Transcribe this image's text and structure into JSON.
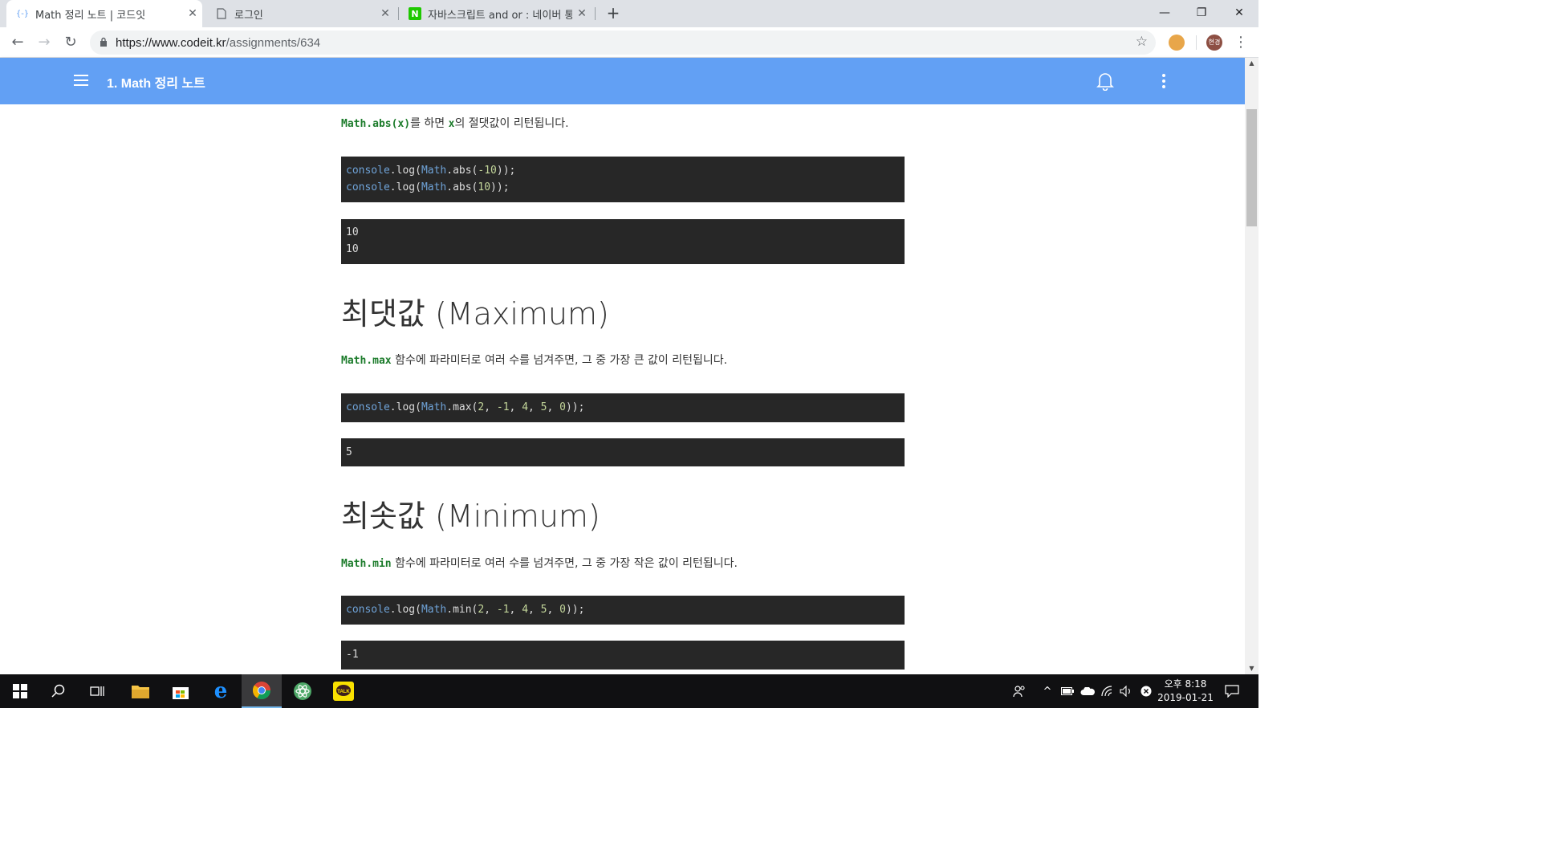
{
  "browser": {
    "tabs": [
      {
        "title": "Math 정리 노트 | 코드잇",
        "favicon": "codeit-favicon",
        "active": true
      },
      {
        "title": "로그인",
        "favicon": "page-icon",
        "active": false
      },
      {
        "title": "자바스크립트 and or : 네이버 통",
        "favicon": "naver-favicon",
        "active": false
      }
    ],
    "new_tab": "+",
    "url_host": "https://www.codeit.kr",
    "url_path": "/assignments/634",
    "profile_initials": "현경"
  },
  "app": {
    "title": "1. Math 정리 노트"
  },
  "content": {
    "abs_para": {
      "code1": "Math.abs(x)",
      "text1": "를 하면 ",
      "code2": "x",
      "text2": "의 절댓값이 리턴됩니다."
    },
    "abs_code": [
      {
        "obj": "console",
        "fn": ".log(",
        "obj2": "Math",
        "fn2": ".abs(",
        "num": "-10",
        "end": "));"
      },
      {
        "obj": "console",
        "fn": ".log(",
        "obj2": "Math",
        "fn2": ".abs(",
        "num": "10",
        "end": "));"
      }
    ],
    "abs_output": [
      "10",
      "10"
    ],
    "max_heading": "최댓값 (Maximum)",
    "max_para": {
      "code": "Math.max",
      "text": " 함수에 파라미터로 여러 수를 넘겨주면, 그 중 가장 큰 값이 리턴됩니다."
    },
    "max_code": {
      "obj": "console",
      "fn": ".log(",
      "obj2": "Math",
      "fn2": ".max(",
      "args": [
        "2",
        "-1",
        "4",
        "5",
        "0"
      ],
      "end": "));"
    },
    "max_output": "5",
    "min_heading": "최솟값 (Minimum)",
    "min_para": {
      "code": "Math.min",
      "text": " 함수에 파라미터로 여러 수를 넘겨주면, 그 중 가장 작은 값이 리턴됩니다."
    },
    "min_code": {
      "obj": "console",
      "fn": ".log(",
      "obj2": "Math",
      "fn2": ".min(",
      "args": [
        "2",
        "-1",
        "4",
        "5",
        "0"
      ],
      "end": "));"
    },
    "min_output": "-1"
  },
  "taskbar": {
    "time": "오후 8:18",
    "date": "2019-01-21"
  },
  "colors": {
    "appbar": "#62a0f4",
    "code_bg": "#272727",
    "inline_code": "#1b7b2a"
  }
}
